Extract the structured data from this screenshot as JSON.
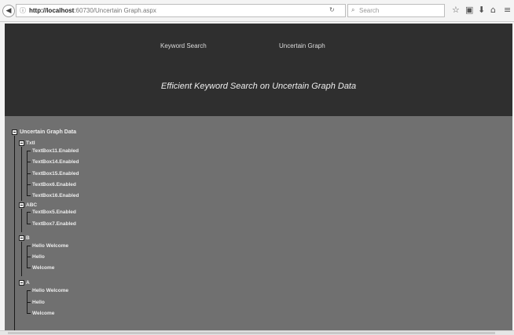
{
  "browser": {
    "url_host": "http://localhost",
    "url_path": ":60730/Uncertain Graph.aspx",
    "search_placeholder": "Search"
  },
  "header": {
    "nav": [
      "Keyword Search",
      "Uncertain Graph"
    ],
    "title": "Efficient Keyword Search on Uncertain Graph Data"
  },
  "tree": {
    "root": "Uncertain Graph Data",
    "groups": [
      {
        "label": "TxtI",
        "items": [
          "TextBox11.Enabled",
          "TextBox14.Enabled",
          "TextBox15.Enabled",
          "TextBox6.Enabled",
          "TextBox16.Enabled"
        ]
      },
      {
        "label": "ABC",
        "items": [
          "TextBox5.Enabled",
          "TextBox7.Enabled"
        ]
      },
      {
        "label": "B",
        "items": [
          "Hello Welcome",
          "Hello",
          "Welcome"
        ]
      },
      {
        "label": "A",
        "items": [
          "Hello Welcome",
          "Hello",
          "Welcome"
        ]
      }
    ]
  }
}
